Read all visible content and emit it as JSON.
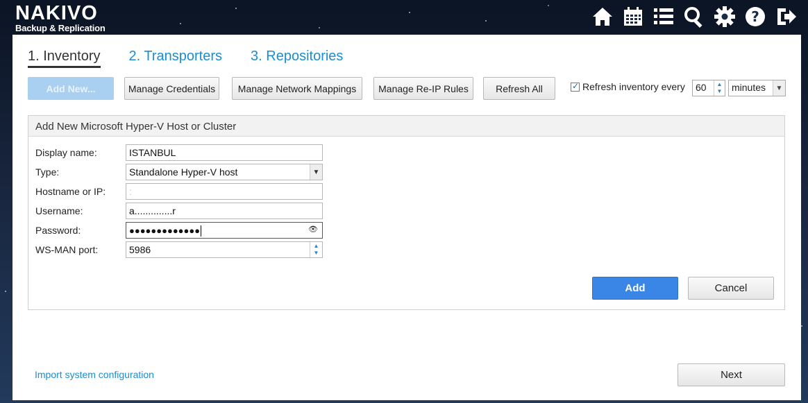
{
  "brand": {
    "name": "NAKIVO",
    "tagline": "Backup & Replication"
  },
  "top_icons": [
    "home-icon",
    "calendar-icon",
    "list-icon",
    "search-icon",
    "gear-icon",
    "help-icon",
    "logout-icon"
  ],
  "steps": [
    {
      "label": "1. Inventory",
      "active": true
    },
    {
      "label": "2. Transporters",
      "active": false
    },
    {
      "label": "3. Repositories",
      "active": false
    }
  ],
  "toolbar": {
    "add_new": "Add New...",
    "manage_credentials": "Manage Credentials",
    "manage_network_mappings": "Manage Network Mappings",
    "manage_reip_rules": "Manage Re-IP Rules",
    "refresh_all": "Refresh All",
    "refresh_label": "Refresh inventory every",
    "refresh_checked": true,
    "refresh_value": "60",
    "refresh_unit": "minutes"
  },
  "form": {
    "title": "Add New Microsoft Hyper-V Host or Cluster",
    "display_name_label": "Display name:",
    "display_name_value": "ISTANBUL",
    "type_label": "Type:",
    "type_value": "Standalone Hyper-V host",
    "hostname_label": "Hostname or IP:",
    "hostname_value": ":",
    "username_label": "Username:",
    "username_value": "a..............r",
    "password_label": "Password:",
    "password_value": "●●●●●●●●●●●●●",
    "wsman_label": "WS-MAN port:",
    "wsman_value": "5986",
    "add_button": "Add",
    "cancel_button": "Cancel"
  },
  "footer": {
    "import_link": "Import system configuration",
    "next_button": "Next"
  },
  "colors": {
    "accent": "#1a8dd4",
    "primary_button": "#3a86e6"
  }
}
